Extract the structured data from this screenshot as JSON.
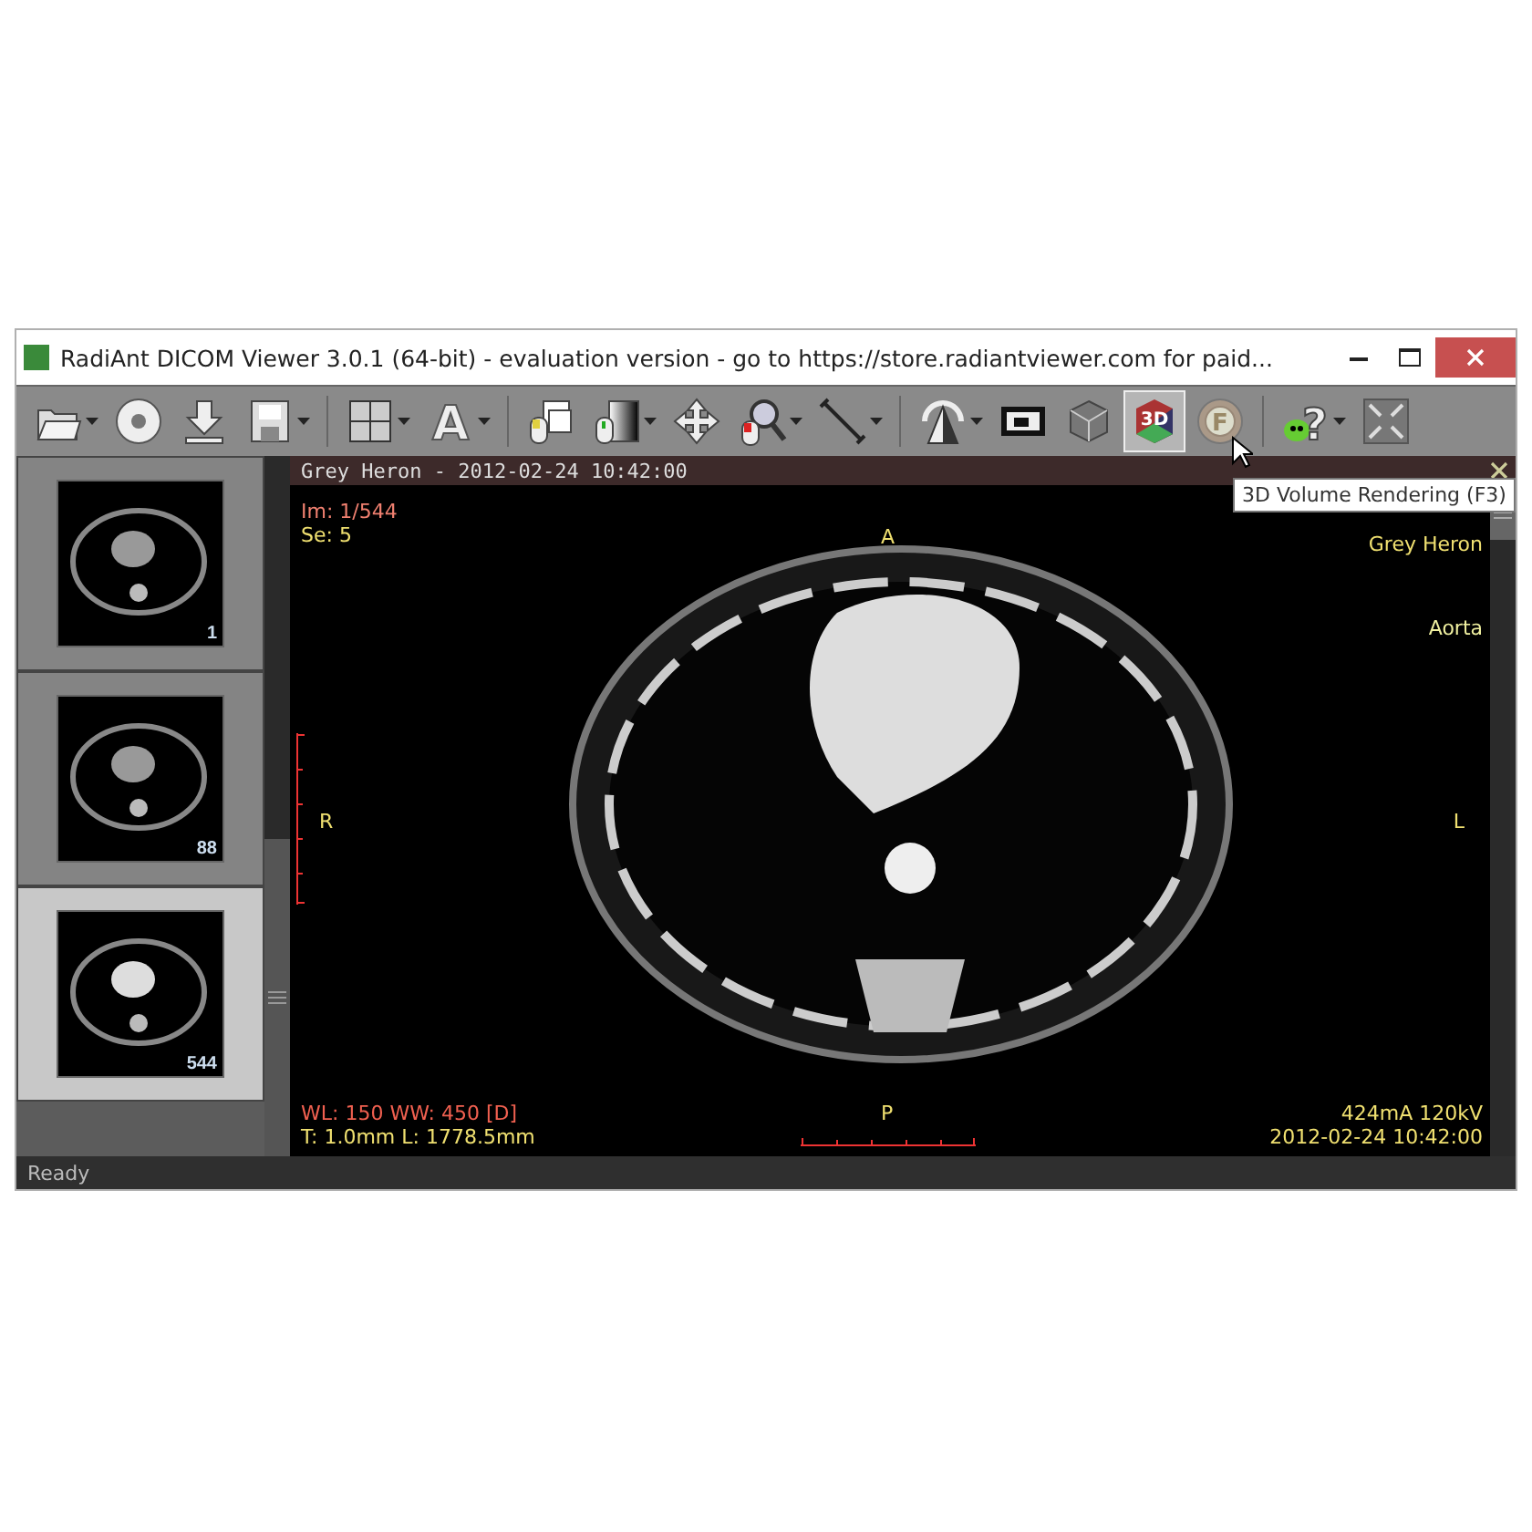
{
  "window": {
    "title": "RadiAnt DICOM Viewer 3.0.1 (64-bit) - evaluation version - go to https://store.radiantviewer.com for paid..."
  },
  "toolbar": [
    {
      "kind": "folder",
      "menu": true,
      "selected": false
    },
    {
      "kind": "disc",
      "menu": false,
      "selected": false
    },
    {
      "kind": "download",
      "menu": false,
      "selected": false
    },
    {
      "kind": "save",
      "menu": true,
      "selected": false
    },
    {
      "kind": "separator"
    },
    {
      "kind": "layout",
      "menu": true,
      "selected": false
    },
    {
      "kind": "glyph",
      "glyph": "A",
      "menu": true,
      "selected": false
    },
    {
      "kind": "separator"
    },
    {
      "kind": "series",
      "menu": false,
      "selected": false
    },
    {
      "kind": "contrast",
      "menu": true,
      "selected": false
    },
    {
      "kind": "pan",
      "menu": false,
      "selected": false
    },
    {
      "kind": "zoom",
      "menu": true,
      "selected": false
    },
    {
      "kind": "measure",
      "menu": true,
      "selected": false
    },
    {
      "kind": "separator"
    },
    {
      "kind": "rotate",
      "menu": true,
      "selected": false
    },
    {
      "kind": "cine",
      "menu": false,
      "selected": false
    },
    {
      "kind": "cube",
      "menu": false,
      "selected": false
    },
    {
      "kind": "glyph3d",
      "glyph": "3D",
      "menu": false,
      "selected": true
    },
    {
      "kind": "fusion",
      "glyph": "F",
      "menu": false,
      "selected": false
    },
    {
      "kind": "separator"
    },
    {
      "kind": "help",
      "glyph": "?",
      "menu": true,
      "selected": false
    },
    {
      "kind": "fullscreen",
      "menu": false,
      "selected": false
    }
  ],
  "tooltip": "3D Volume Rendering (F3)",
  "thumbnails": [
    {
      "label": "1",
      "selected": false
    },
    {
      "label": "88",
      "selected": false
    },
    {
      "label": "544",
      "selected": true
    }
  ],
  "viewer": {
    "header": "Grey Heron - 2012-02-24 10:42:00",
    "top_left": [
      {
        "text": "Im: 1/544",
        "color": "#f08070"
      },
      {
        "text": "Se: 5",
        "color": "#f0e070"
      }
    ],
    "top_right": [
      {
        "text": "Grey Heron",
        "color": "#f0e070"
      }
    ],
    "label_aorta": "Aorta",
    "orientation": {
      "top": "A",
      "left": "R",
      "right": "L",
      "bottom": "P"
    },
    "bottom_left": [
      {
        "text": "WL: 150 WW: 450 [D]",
        "color": "#f06050"
      },
      {
        "text": "T: 1.0mm L: 1778.5mm",
        "color": "#f0e070"
      }
    ],
    "bottom_right": [
      {
        "text": "424mA 120kV",
        "color": "#f0e070"
      },
      {
        "text": "2012-02-24 10:42:00",
        "color": "#f0e070"
      }
    ]
  },
  "status_bar": "Ready"
}
